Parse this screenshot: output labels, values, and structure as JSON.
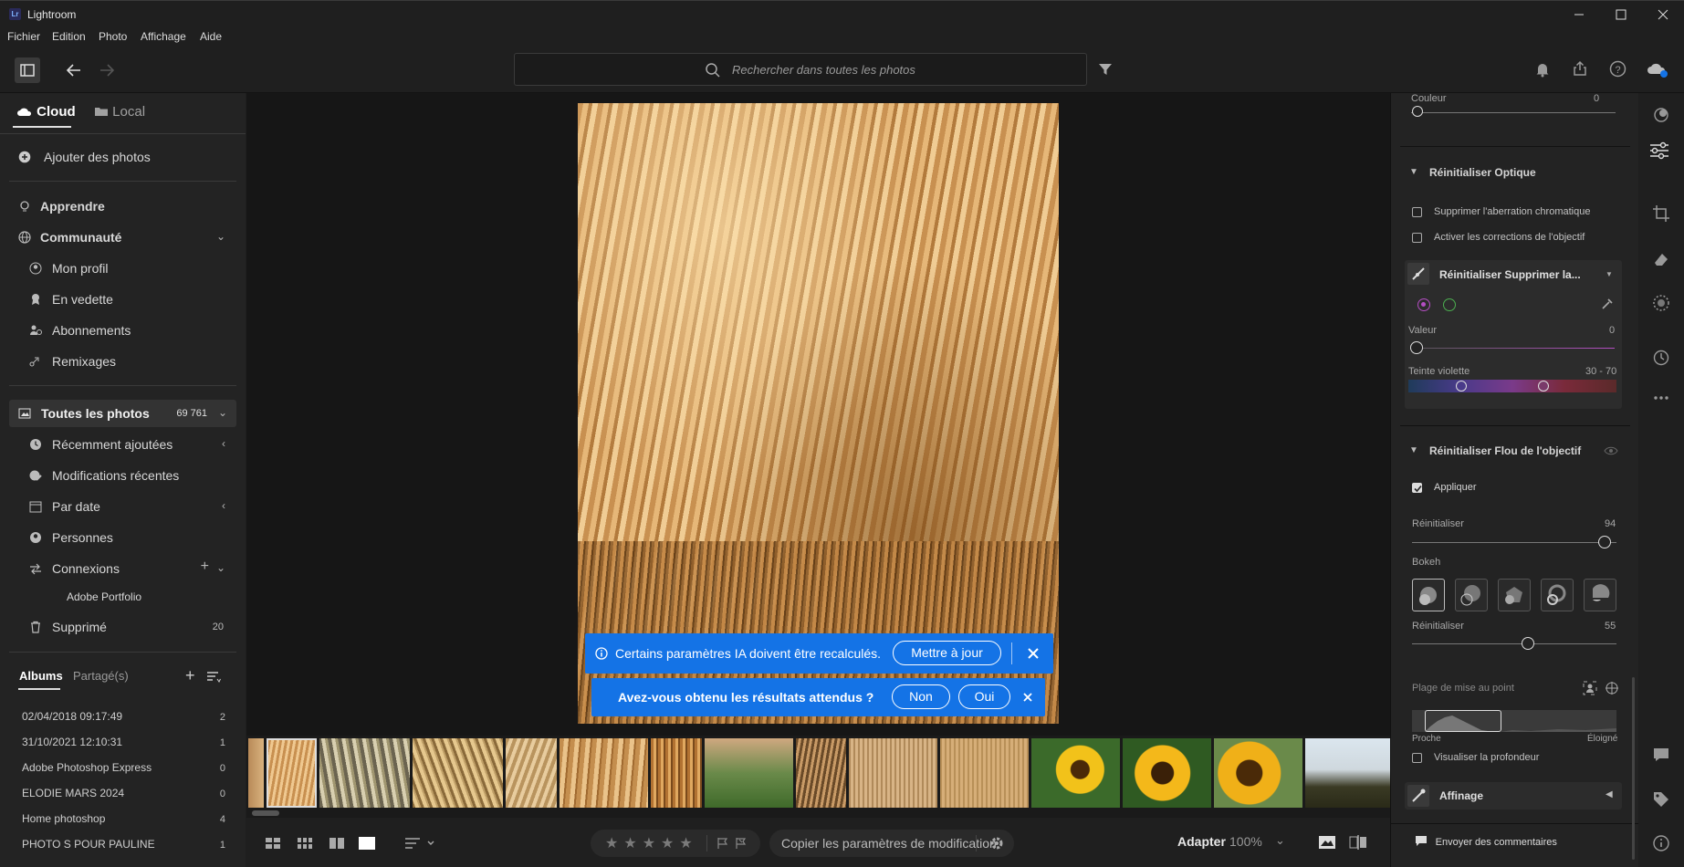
{
  "app": {
    "title": "Lightroom",
    "logo_text": "Lr"
  },
  "menu": [
    "Fichier",
    "Edition",
    "Photo",
    "Affichage",
    "Aide"
  ],
  "search": {
    "placeholder": "Rechercher dans toutes les photos"
  },
  "left": {
    "tabs": {
      "cloud": "Cloud",
      "local": "Local"
    },
    "add_photos": "Ajouter des photos",
    "learn": "Apprendre",
    "community": "Communauté",
    "community_items": [
      "Mon profil",
      "En vedette",
      "Abonnements",
      "Remixages"
    ],
    "all_photos": {
      "label": "Toutes les photos",
      "count": "69 761"
    },
    "library_items": [
      "Récemment ajoutées",
      "Modifications récentes",
      "Par date",
      "Personnes",
      "Connexions"
    ],
    "adobe_portfolio": "Adobe Portfolio",
    "deleted": {
      "label": "Supprimé",
      "count": "20"
    },
    "album_tabs": {
      "albums": "Albums",
      "shared": "Partagé(s)"
    },
    "albums": [
      {
        "name": "02/04/2018 09:17:49",
        "count": "2"
      },
      {
        "name": "31/10/2021 12:10:31",
        "count": "1"
      },
      {
        "name": "Adobe Photoshop Express",
        "count": "0"
      },
      {
        "name": "ELODIE MARS 2024",
        "count": "0"
      },
      {
        "name": "Home photoshop",
        "count": "4"
      },
      {
        "name": "PHOTO S POUR PAULINE",
        "count": "1"
      }
    ]
  },
  "banner": {
    "message": "Certains paramètres IA doivent être recalculés.",
    "update_label": "Mettre à jour",
    "question": "Avez-vous obtenu les résultats attendus ?",
    "no_label": "Non",
    "yes_label": "Oui"
  },
  "bottom": {
    "copy_settings": "Copier les paramètres de modification",
    "fit_label": "Adapter",
    "zoom": "100%"
  },
  "right": {
    "color_label": "Couleur",
    "color_value": "0",
    "optics_title": "Réinitialiser Optique",
    "remove_chromatic": "Supprimer l'aberration chromatique",
    "enable_lens": "Activer les corrections de l'objectif",
    "defringe_title": "Réinitialiser Supprimer la...",
    "value_label": "Valeur",
    "value_value": "0",
    "purple_label": "Teinte violette",
    "purple_value": "30 - 70",
    "lensblur_title": "Réinitialiser Flou de l'objectif",
    "apply_label": "Appliquer",
    "reset1_label": "Réinitialiser",
    "reset1_value": "94",
    "bokeh_label": "Bokeh",
    "reset2_label": "Réinitialiser",
    "reset2_value": "55",
    "focus_range_label": "Plage de mise au point",
    "near_label": "Proche",
    "far_label": "Éloigné",
    "visualize_depth": "Visualiser la profondeur",
    "refine_label": "Affinage",
    "feedback_label": "Envoyer des commentaires"
  },
  "colors": {
    "accent": "#1473e6",
    "panel": "#232323",
    "center": "#161616"
  }
}
